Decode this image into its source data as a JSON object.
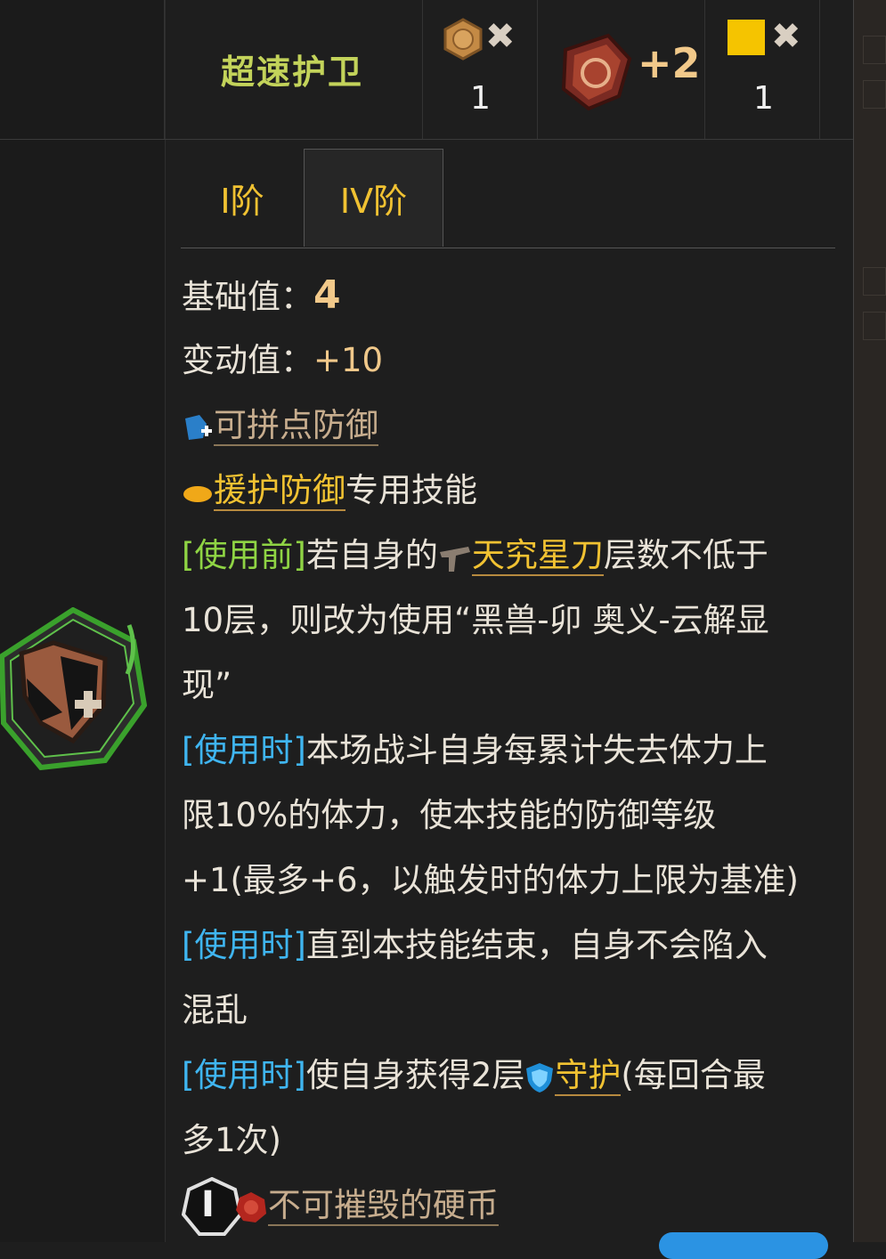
{
  "header": {
    "skill_name": "超速护卫",
    "costs": [
      {
        "icon": "bronze-coin-icon",
        "symbol": "✖",
        "count": "1"
      },
      {
        "icon": "shield-emblem-icon",
        "label": "+2"
      },
      {
        "icon": "yellow-square-icon",
        "symbol": "✖",
        "count": "1"
      }
    ]
  },
  "tabs": [
    {
      "label": "I阶",
      "active": false
    },
    {
      "label": "IV阶",
      "active": true
    }
  ],
  "stats": {
    "base_label": "基础值：",
    "base_value": "4",
    "delta_label": "变动值：",
    "delta_value": "+10"
  },
  "traits": {
    "stackable": "可拼点防御",
    "support_defense": "援护防御",
    "exclusive_suffix": "专用技能"
  },
  "effects": {
    "before_tag": "[使用前]",
    "before_text1": "若自身的",
    "before_keyword": "天究星刀",
    "before_text2": "层数不低于",
    "before_line2": "10层，则改为使用“黑兽-卯 奥义-云解显",
    "before_line3": "现”",
    "use1_tag": "[使用时]",
    "use1_text": "本场战斗自身每累计失去体力上",
    "use1_line2": "限10%的体力，使本技能的防御等级",
    "use1_line3": "+1(最多+6，以触发时的体力上限为基准)",
    "use2_tag": "[使用时]",
    "use2_text": "直到本技能结束，自身不会陷入",
    "use2_line2": "混乱",
    "use3_tag": "[使用时]",
    "use3_text": "使自身获得2层",
    "use3_keyword": "守护",
    "use3_text2": "(每回合最",
    "use3_line2": "多1次)"
  },
  "footer": {
    "tier_badge": "I",
    "unbreakable": "不可摧毁的硬币"
  },
  "colors": {
    "skill_name": "#c3d35a",
    "tab_text": "#f1c232",
    "tag_before": "#8fd444",
    "tag_use": "#3fb5f0",
    "keyword": "#f1c232"
  }
}
